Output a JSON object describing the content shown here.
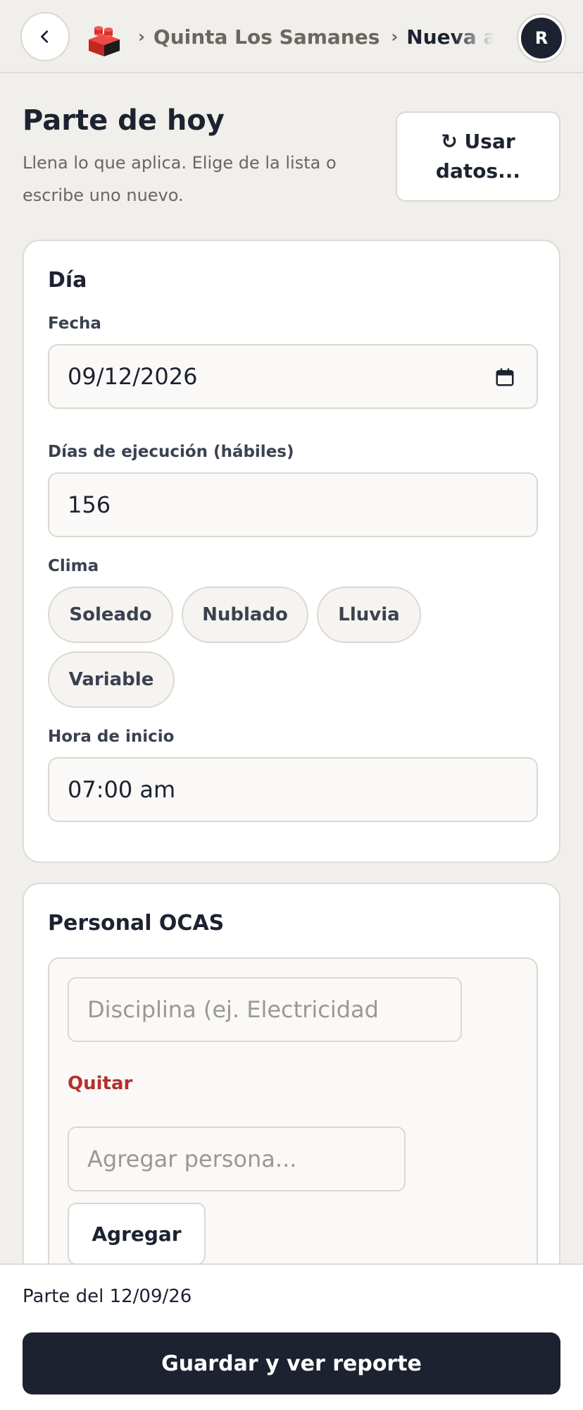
{
  "header": {
    "breadcrumbs": [
      "Quinta Los Samanes",
      "Nueva ap"
    ],
    "avatar_initial": "R"
  },
  "page": {
    "title": "Parte de hoy",
    "subtitle": "Llena lo que aplica. Elige de la lista o escribe uno nuevo.",
    "use_data_button": "↻ Usar datos..."
  },
  "dia": {
    "title": "Día",
    "fecha_label": "Fecha",
    "fecha_value": "09/12/2026",
    "dias_label": "Días de ejecución (hábiles)",
    "dias_value": "156",
    "clima_label": "Clima",
    "clima_options": [
      "Soleado",
      "Nublado",
      "Lluvia",
      "Variable"
    ],
    "hora_label": "Hora de inicio",
    "hora_value": "07:00 am"
  },
  "personal": {
    "title": "Personal OCAS",
    "discipline_placeholder": "Disciplina (ej. Electricidad",
    "remove_label": "Quitar",
    "person_placeholder": "Agregar persona...",
    "add_label": "Agregar"
  },
  "footer": {
    "status": "Parte del 12/09/26",
    "save_button": "Guardar y ver reporte"
  },
  "colors": {
    "background": "#f1efeb",
    "primary": "#1c2230",
    "danger": "#b5302a",
    "logo": "#e0312b"
  }
}
